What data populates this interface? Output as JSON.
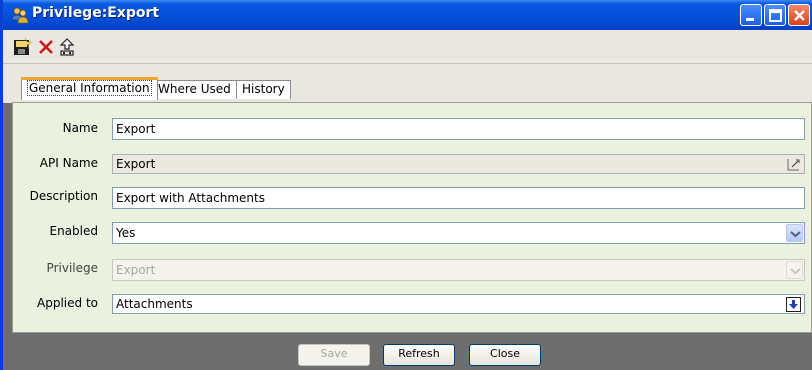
{
  "window": {
    "title": "Privilege:Export",
    "colors": {
      "titlebar": "#0352dd",
      "panel": "#eaf1df",
      "frame": "#6e6e6e",
      "tab_accent": "#f3a530"
    }
  },
  "toolbar": {
    "icons": [
      "save-icon",
      "delete-icon",
      "export-icon"
    ]
  },
  "tabs": [
    {
      "label": "General Information",
      "active": true
    },
    {
      "label": "Where Used",
      "active": false
    },
    {
      "label": "History",
      "active": false
    }
  ],
  "form": {
    "name": {
      "label": "Name",
      "value": "Export"
    },
    "api_name": {
      "label": "API Name",
      "value": "Export"
    },
    "description": {
      "label": "Description",
      "value": "Export with Attachments"
    },
    "enabled": {
      "label": "Enabled",
      "value": "Yes"
    },
    "privilege": {
      "label": "Privilege",
      "value": "Export"
    },
    "applied_to": {
      "label": "Applied to",
      "value": "Attachments"
    }
  },
  "buttons": {
    "save": "Save",
    "refresh": "Refresh",
    "close": "Close"
  }
}
